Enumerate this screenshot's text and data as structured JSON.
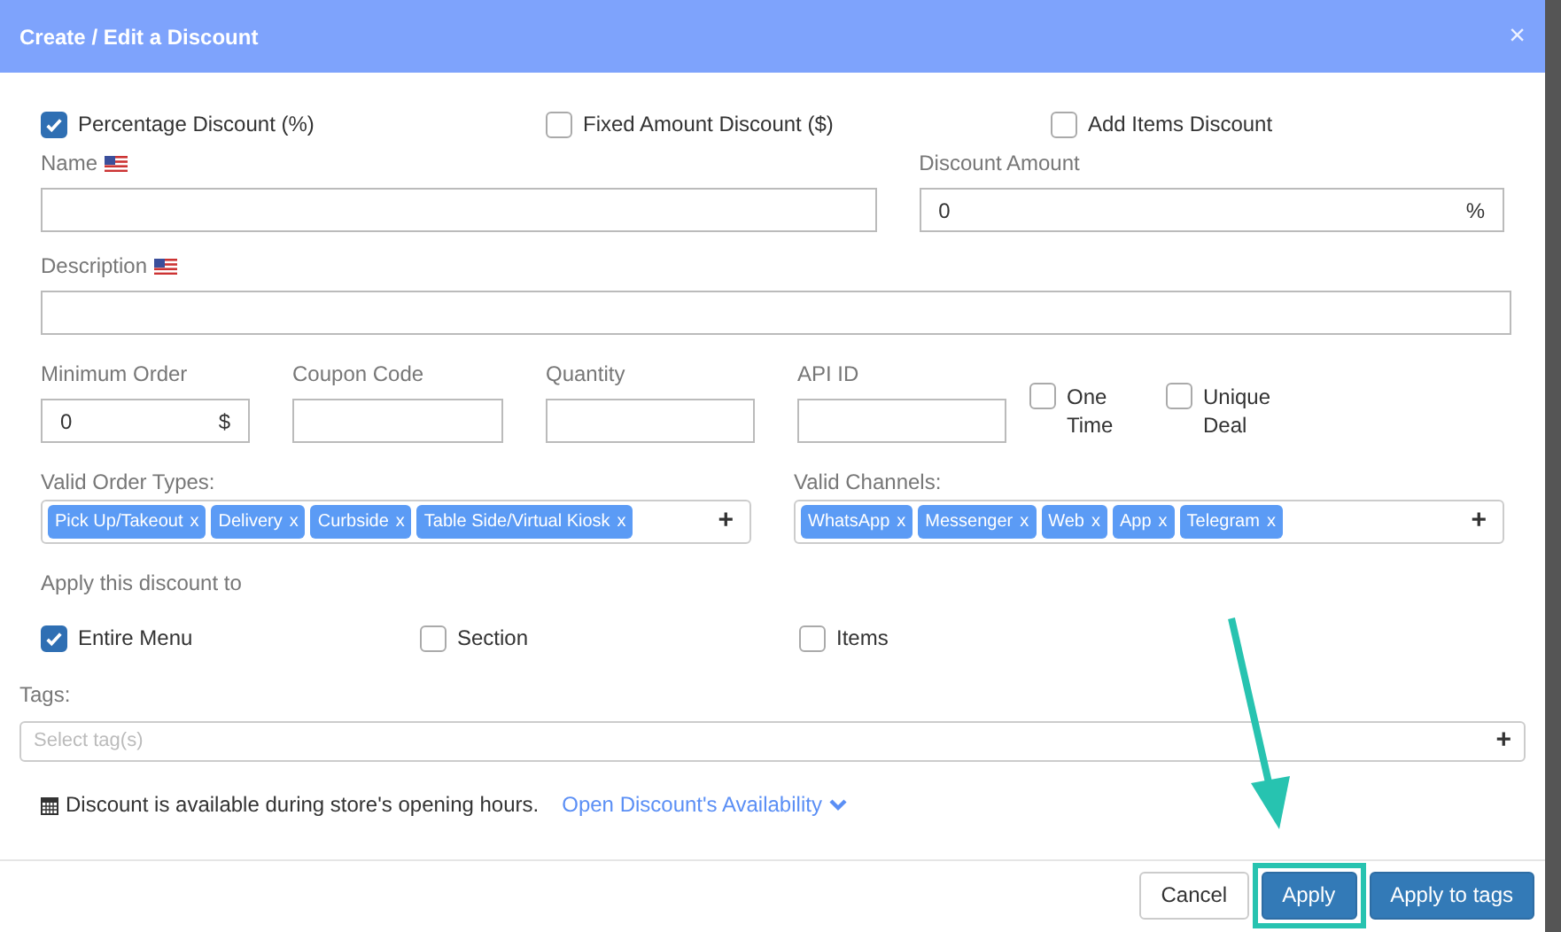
{
  "window": {
    "title": "Create / Edit a Discount",
    "close": "×"
  },
  "discount_types": [
    {
      "label": "Percentage Discount",
      "symbol": "(%)",
      "checked": true
    },
    {
      "label": "Fixed Amount Discount",
      "symbol": "($)",
      "checked": false
    },
    {
      "label": "Add Items Discount",
      "checked": false
    }
  ],
  "name": {
    "label": "Name"
  },
  "discount_amount": {
    "label": "Discount Amount",
    "value": "0",
    "unit": "%"
  },
  "description": {
    "label": "Description"
  },
  "minimum_order": {
    "label": "Minimum Order",
    "value": "0",
    "unit": "$"
  },
  "coupon_code": {
    "label": "Coupon Code"
  },
  "quantity": {
    "label": "Quantity"
  },
  "api_id": {
    "label": "API ID"
  },
  "flags": [
    {
      "label": "One Time",
      "checked": false
    },
    {
      "label": "Unique Deal",
      "checked": false
    }
  ],
  "valid_order_types": {
    "label": "Valid Order Types:",
    "tags": [
      {
        "label": "Pick Up/Takeout",
        "remove": "x"
      },
      {
        "label": "Delivery",
        "remove": "x"
      },
      {
        "label": "Curbside",
        "remove": "x"
      },
      {
        "label": "Table Side/Virtual Kiosk",
        "remove": "x"
      }
    ],
    "add": "+"
  },
  "valid_channels": {
    "label": "Valid Channels:",
    "tags": [
      {
        "label": "WhatsApp",
        "remove": "x"
      },
      {
        "label": "Messenger",
        "remove": "x"
      },
      {
        "label": "Web",
        "remove": "x"
      },
      {
        "label": "App",
        "remove": "x"
      },
      {
        "label": "Telegram",
        "remove": "x"
      }
    ],
    "add": "+"
  },
  "apply_to": {
    "label": "Apply this discount to",
    "options": [
      {
        "label": "Entire Menu",
        "checked": true
      },
      {
        "label": "Section",
        "checked": false
      },
      {
        "label": "Items",
        "checked": false
      }
    ]
  },
  "tags": {
    "label": "Tags:",
    "placeholder": "Select tag(s)",
    "add": "+"
  },
  "availability": {
    "text": "Discount is available during store's opening hours.",
    "link": "Open Discount's Availability"
  },
  "buttons": [
    {
      "label": "Cancel",
      "kind": "default",
      "highlighted": false
    },
    {
      "label": "Apply",
      "kind": "primary",
      "highlighted": true
    },
    {
      "label": "Apply to tags",
      "kind": "primary",
      "highlighted": false
    }
  ]
}
